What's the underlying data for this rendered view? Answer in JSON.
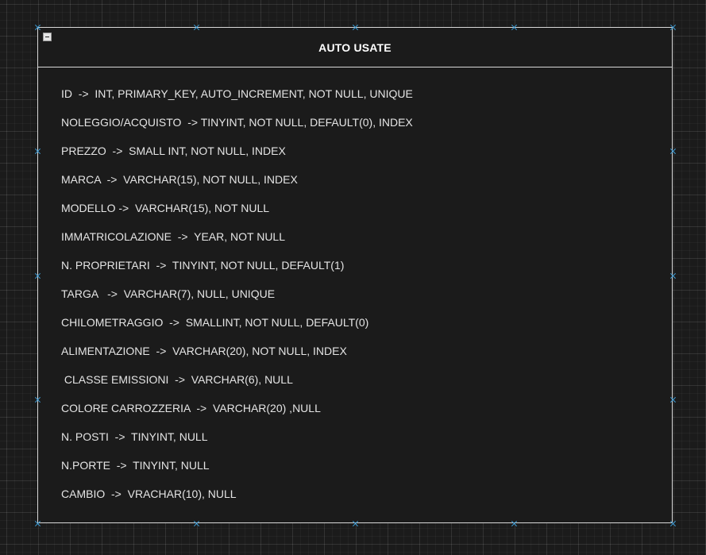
{
  "entity": {
    "title": "AUTO USATE",
    "attributes": [
      "ID  ->  INT, PRIMARY_KEY, AUTO_INCREMENT, NOT NULL, UNIQUE",
      "NOLEGGIO/ACQUISTO  -> TINYINT, NOT NULL, DEFAULT(0), INDEX",
      "PREZZO  ->  SMALL INT, NOT NULL, INDEX",
      "MARCA  ->  VARCHAR(15), NOT NULL, INDEX",
      "MODELLO ->  VARCHAR(15), NOT NULL",
      "IMMATRICOLAZIONE  ->  YEAR, NOT NULL",
      "N. PROPRIETARI  ->  TINYINT, NOT NULL, DEFAULT(1)",
      "TARGA   ->  VARCHAR(7), NULL, UNIQUE",
      "CHILOMETRAGGIO  ->  SMALLINT, NOT NULL, DEFAULT(0)",
      "ALIMENTAZIONE  ->  VARCHAR(20), NOT NULL, INDEX",
      " CLASSE EMISSIONI  ->  VARCHAR(6), NULL",
      "COLORE CARROZZERIA  ->  VARCHAR(20) ,NULL",
      "N. POSTI  ->  TINYINT, NULL",
      "N.PORTE  ->  TINYINT, NULL",
      "CAMBIO  ->  VRACHAR(10), NULL"
    ]
  },
  "colors": {
    "canvas_background": "#1b1b1b",
    "border": "#d8d8d8",
    "text": "#e4e4e4",
    "selection_handle": "#3ea3e0"
  },
  "icons": {
    "collapse": "minus-box-icon",
    "handle": "x-cross-handle-icon"
  }
}
